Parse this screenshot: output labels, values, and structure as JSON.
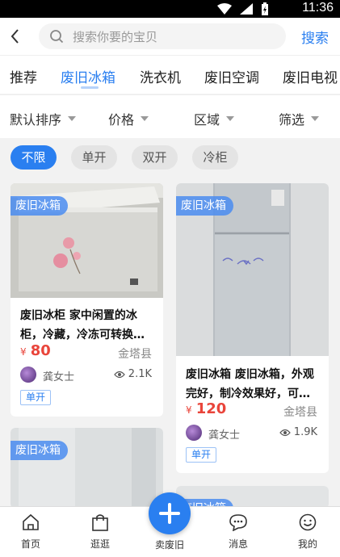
{
  "status_bar": {
    "time": "11:36"
  },
  "search": {
    "placeholder": "搜索你要的宝贝",
    "button_label": "搜索"
  },
  "categories": [
    {
      "label": "推荐",
      "active": false
    },
    {
      "label": "废旧冰箱",
      "active": true
    },
    {
      "label": "洗衣机",
      "active": false
    },
    {
      "label": "废旧空调",
      "active": false
    },
    {
      "label": "废旧电视",
      "active": false
    }
  ],
  "filters": [
    {
      "label": "默认排序"
    },
    {
      "label": "价格"
    },
    {
      "label": "区域"
    },
    {
      "label": "筛选"
    }
  ],
  "chips": [
    {
      "label": "不限",
      "active": true
    },
    {
      "label": "单开",
      "active": false
    },
    {
      "label": "双开",
      "active": false
    },
    {
      "label": "冷柜",
      "active": false
    }
  ],
  "listings": [
    {
      "tag": "废旧冰箱",
      "title": "废旧冰柜 家中闲置的冰柜，冷藏，冷冻可转换…",
      "currency": "¥",
      "price": "80",
      "location": "金塔县",
      "seller": "龚女士",
      "views": "2.1K",
      "badge": "单开"
    },
    {
      "tag": "废旧冰箱",
      "title": "废旧冰箱 废旧冰箱，外观完好，制冷效果好，可…",
      "currency": "¥",
      "price": "120",
      "location": "金塔县",
      "seller": "龚女士",
      "views": "1.9K",
      "badge": "单开"
    },
    {
      "tag": "废旧冰箱"
    },
    {
      "tag": "废旧冰箱"
    }
  ],
  "tabbar": [
    {
      "label": "首页",
      "icon": "home-icon"
    },
    {
      "label": "逛逛",
      "icon": "shopping-bag-icon"
    },
    {
      "label": "卖废旧",
      "icon": "plus-icon"
    },
    {
      "label": "消息",
      "icon": "chat-icon"
    },
    {
      "label": "我的",
      "icon": "smiley-face-icon"
    }
  ],
  "colors": {
    "accent": "#2a7ff0",
    "price": "#e9453b"
  }
}
